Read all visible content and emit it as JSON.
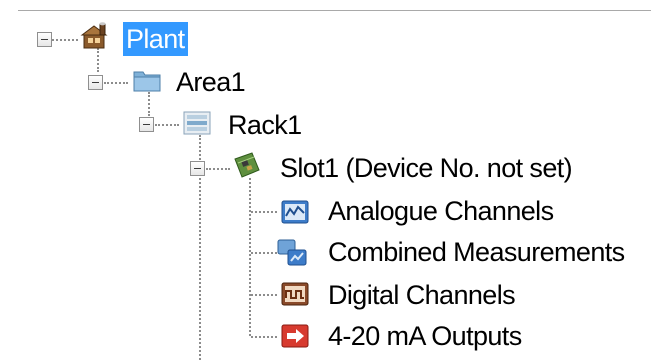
{
  "colors": {
    "selection": "#3399ff",
    "connector": "#8c8c8c"
  },
  "tree": {
    "plant": {
      "label": "Plant",
      "icon": "plant-icon",
      "expanded": true,
      "selected": true
    },
    "area": {
      "label": "Area1",
      "icon": "folder-icon",
      "expanded": true
    },
    "rack": {
      "label": "Rack1",
      "icon": "rack-icon",
      "expanded": true
    },
    "slot": {
      "label": "Slot1 (Device No. not set)",
      "icon": "slot-board-icon",
      "expanded": true
    },
    "children": [
      {
        "label": "Analogue Channels",
        "icon": "analogue-channels-icon"
      },
      {
        "label": "Combined Measurements",
        "icon": "combined-measurements-icon"
      },
      {
        "label": "Digital Channels",
        "icon": "digital-channels-icon"
      },
      {
        "label": "4-20 mA Outputs",
        "icon": "ma-outputs-icon"
      }
    ]
  }
}
